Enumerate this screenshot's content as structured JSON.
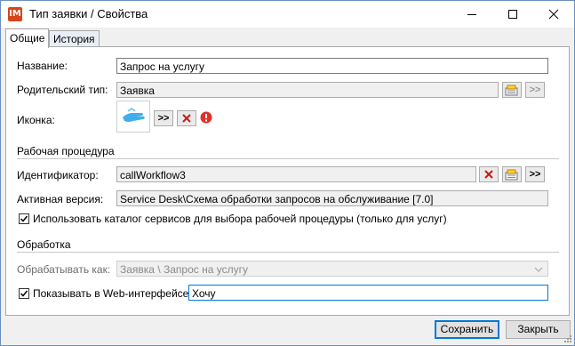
{
  "window": {
    "title": "Тип заявки / Свойства",
    "app_icon_text": "IM"
  },
  "tabs": [
    {
      "label": "Общие",
      "active": true
    },
    {
      "label": "История",
      "active": false
    }
  ],
  "general": {
    "name_label": "Название:",
    "name_value": "Запрос на услугу",
    "parent_label": "Родительский тип:",
    "parent_value": "Заявка",
    "icon_label": "Иконка:",
    "browse_label": ">>",
    "clear_label": "x"
  },
  "workflow": {
    "group_title": "Рабочая процедура",
    "id_label": "Идентификатор:",
    "id_value": "callWorkflow3",
    "active_version_label": "Активная версия:",
    "active_version_value": "Service Desk\\Схема обработки запросов на обслуживание [7.0]",
    "use_catalog_label": "Использовать каталог сервисов для выбора рабочей процедуры (только для услуг)",
    "use_catalog_checked": true
  },
  "processing": {
    "group_title": "Обработка",
    "process_as_label": "Обрабатывать как:",
    "process_as_value": "Заявка \\ Запрос на услугу",
    "show_web_label": "Показывать в Web-интерфейсе",
    "show_web_checked": true,
    "show_web_value": "Хочу"
  },
  "buttons": {
    "save": "Сохранить",
    "close": "Закрыть"
  },
  "colors": {
    "accent": "#0078d7",
    "app_icon": "#d9441a",
    "error": "#e0312a",
    "clear_x": "#cc1a1a"
  }
}
